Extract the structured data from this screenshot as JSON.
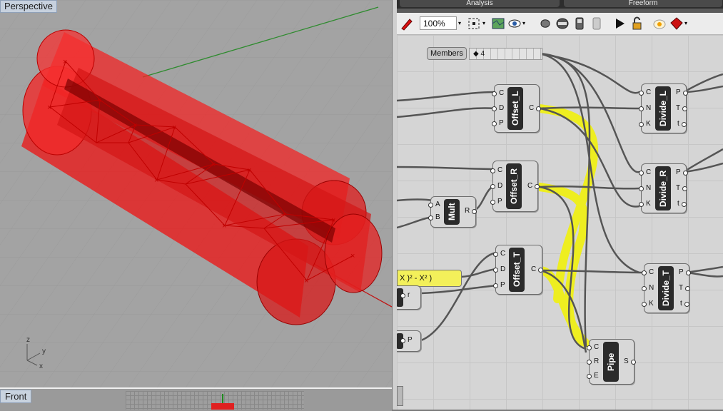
{
  "viewport": {
    "title": "Perspective",
    "axis_labels": {
      "z": "z",
      "y": "y",
      "x": "x"
    },
    "secondary_tab": "Front"
  },
  "grasshopper": {
    "tabs": [
      "Analysis",
      "Freeform"
    ],
    "zoom": "100%",
    "members": {
      "label": "Members",
      "value": "◆ 4"
    },
    "expression_fragment": "X )² - X² )",
    "components": [
      {
        "id": "offset_l",
        "name": "Offset_L",
        "inputs": [
          "C",
          "D",
          "P"
        ],
        "outputs": [
          "C"
        ]
      },
      {
        "id": "offset_r",
        "name": "Offset_R",
        "inputs": [
          "C",
          "D",
          "P"
        ],
        "outputs": [
          "C"
        ]
      },
      {
        "id": "offset_t",
        "name": "Offset_T",
        "inputs": [
          "C",
          "D",
          "P"
        ],
        "outputs": [
          "C"
        ]
      },
      {
        "id": "mult",
        "name": "Mult",
        "inputs": [
          "A",
          "B"
        ],
        "outputs": [
          "R"
        ]
      },
      {
        "id": "divide_l",
        "name": "Divide_L",
        "inputs": [
          "C",
          "N",
          "K"
        ],
        "outputs": [
          "P",
          "T",
          "t"
        ]
      },
      {
        "id": "divide_r",
        "name": "Divide_R",
        "inputs": [
          "C",
          "N",
          "K"
        ],
        "outputs": [
          "P",
          "T",
          "t"
        ]
      },
      {
        "id": "divide_t",
        "name": "Divide_T",
        "inputs": [
          "C",
          "N",
          "K"
        ],
        "outputs": [
          "P",
          "T",
          "t"
        ]
      },
      {
        "id": "pipe",
        "name": "Pipe",
        "inputs": [
          "C",
          "R",
          "E"
        ],
        "outputs": [
          "S"
        ]
      }
    ],
    "partial_components": [
      {
        "id": "partial_r",
        "outputs": [
          "r"
        ]
      },
      {
        "id": "partial_p",
        "outputs": [
          "P"
        ]
      }
    ],
    "colors": {
      "highlight": "#eeee20",
      "geometry": "#ff2020",
      "canvas": "#d5d5d5"
    }
  }
}
